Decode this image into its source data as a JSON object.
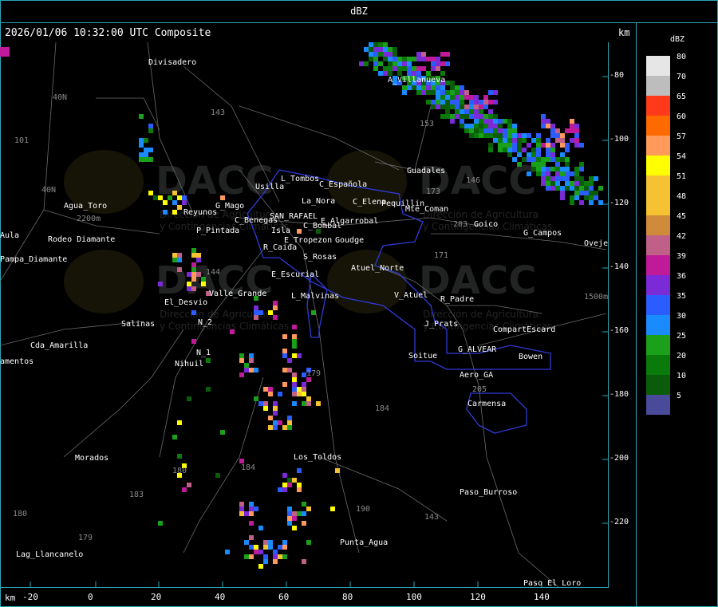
{
  "header": {
    "title": "dBZ",
    "timestamp": "2026/01/06 10:32:00 UTC Composite",
    "km_label": "km"
  },
  "legend": {
    "title": "dBZ",
    "entries": [
      {
        "label": "80",
        "color": "#e6e6e6"
      },
      {
        "label": "70",
        "color": "#bdbdbd"
      },
      {
        "label": "65",
        "color": "#ff3a1a"
      },
      {
        "label": "60",
        "color": "#ff6a00"
      },
      {
        "label": "57",
        "color": "#ff9a5a"
      },
      {
        "label": "54",
        "color": "#ffff00"
      },
      {
        "label": "51",
        "color": "#f6c232"
      },
      {
        "label": "48",
        "color": "#f6c232"
      },
      {
        "label": "45",
        "color": "#d08b3a"
      },
      {
        "label": "42",
        "color": "#c06088"
      },
      {
        "label": "39",
        "color": "#c01a9a"
      },
      {
        "label": "36",
        "color": "#7a2ad6"
      },
      {
        "label": "35",
        "color": "#2a5cff"
      },
      {
        "label": "30",
        "color": "#1a8aff"
      },
      {
        "label": "25",
        "color": "#1aa01a"
      },
      {
        "label": "20",
        "color": "#0a7a0a"
      },
      {
        "label": "10",
        "color": "#0a5c0a"
      },
      {
        "label": "5",
        "color": "#4a4a9a"
      }
    ]
  },
  "axes": {
    "x_label": "km",
    "x_ticks": [
      "-20",
      "0",
      "20",
      "40",
      "60",
      "80",
      "100",
      "120",
      "140"
    ],
    "y_ticks": [
      "-80",
      "-100",
      "-120",
      "-140",
      "-160",
      "-180",
      "-200",
      "-220"
    ]
  },
  "map": {
    "places": [
      "Divisadero",
      "A_Villanueva",
      "Guadales",
      "L_Tombos",
      "Usilla",
      "C_Española",
      "La_Nora",
      "C_Elena",
      "Pequillin",
      "Mte_Coman",
      "Agua_Toro",
      "Rodeo Diamante",
      "Reyunos",
      "G_Mago",
      "C_Benegas",
      "SAN_RAFAEL",
      "E_Algarrobal",
      "C_Bombal",
      "E_Tropezon",
      "Goudge",
      "Isla",
      "Aula",
      "Pampa_Diamante",
      "P_Pintada",
      "R_Caida",
      "S_Rosas",
      "Atuel_Norte",
      "E_Escurial",
      "Valle_Grande",
      "L_Malvinas",
      "V_Atuel",
      "R_Padre",
      "El_Desvio",
      "Salinas",
      "N_2",
      "Cda_Amarilla",
      "N_1",
      "Nihuil",
      "amentos",
      "J_Prats",
      "CompartEscard",
      "G_ALVEAR",
      "Soitue",
      "Bowen",
      "Aero_GA",
      "Carmensa",
      "Morados",
      "Los_Toldos",
      "Paso_Burroso",
      "Punta_Agua",
      "Lag_Llancanelo",
      "Paso_El_Loro",
      "Goico",
      "G_Campos",
      "Oveje"
    ],
    "roads": [
      "40N",
      "101",
      "40N",
      "143",
      "153",
      "173",
      "171",
      "203",
      "146",
      "144",
      "179",
      "184",
      "180",
      "184",
      "183",
      "179",
      "180",
      "190",
      "143",
      "205",
      "1500m",
      "2200m"
    ],
    "watermark": "DACC",
    "watermark_sub1": "Dirección de Agricultura",
    "watermark_sub2": "y Contingencias Climáticas"
  }
}
